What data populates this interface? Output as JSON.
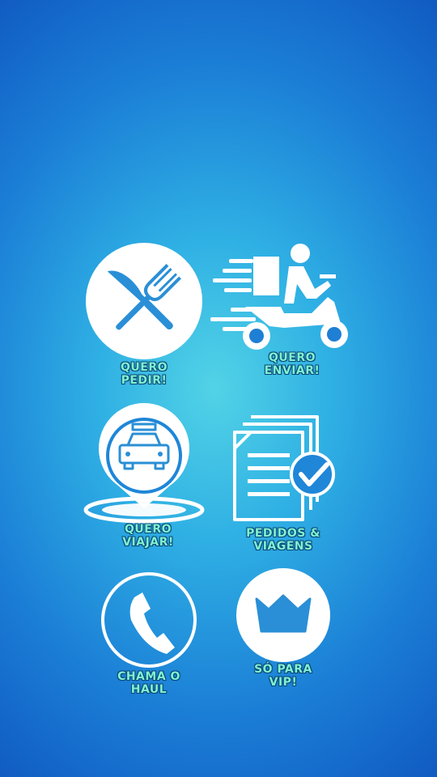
{
  "menu": {
    "items": [
      {
        "id": "quero-pedir",
        "line1": "QUERO",
        "line2": "PEDIR!",
        "icon": "fork-knife-icon"
      },
      {
        "id": "quero-enviar",
        "line1": "QUERO",
        "line2": "ENVIAR!",
        "icon": "delivery-scooter-icon"
      },
      {
        "id": "quero-viajar",
        "line1": "QUERO",
        "line2": "VIAJAR!",
        "icon": "taxi-pin-icon"
      },
      {
        "id": "pedidos-viagens",
        "line1": "PEDIDOS &",
        "line2": "VIAGENS",
        "icon": "documents-check-icon"
      },
      {
        "id": "chama-o-haul",
        "line1": "CHAMA O",
        "line2": "HAUL",
        "icon": "phone-icon"
      },
      {
        "id": "so-para-vip",
        "line1": "SÓ PARA",
        "line2": "VIP!",
        "icon": "crown-icon"
      }
    ]
  },
  "colors": {
    "label": "#7ff2cf",
    "icon": "#ffffff",
    "background_center": "#52d3e6",
    "background_edge": "#0f56bf"
  }
}
